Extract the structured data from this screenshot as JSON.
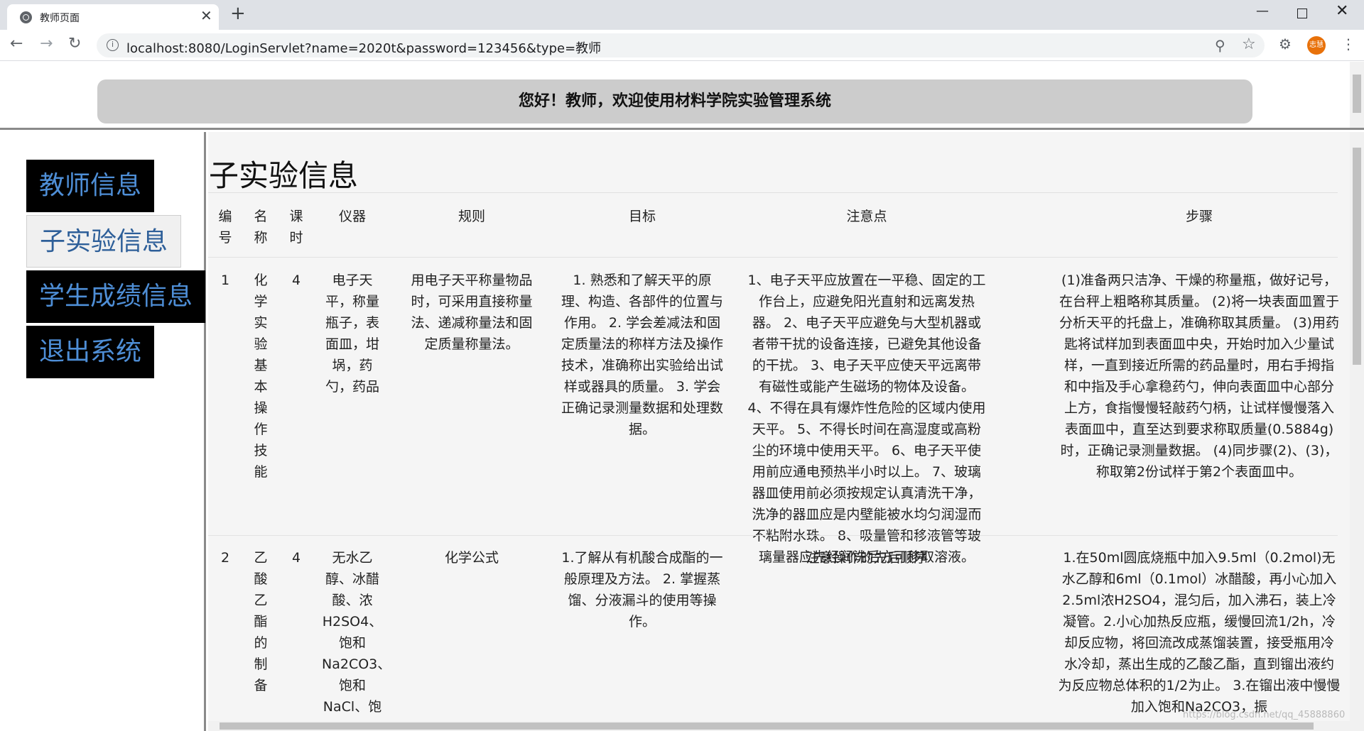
{
  "browser": {
    "tab_title": "教师页面",
    "tab_close": "✕",
    "new_tab": "+",
    "url": "localhost:8080/LoginServlet?name=2020t&password=123456&type=教师",
    "avatar_text": "志慧"
  },
  "header": {
    "welcome": "您好！教师，欢迎使用材料学院实验管理系统"
  },
  "sidebar": {
    "items": [
      {
        "label": "教师信息"
      },
      {
        "label": "子实验信息"
      },
      {
        "label": "学生成绩信息"
      },
      {
        "label": "退出系统"
      }
    ]
  },
  "main": {
    "title": "子实验信息",
    "columns": [
      "编号",
      "名称",
      "课时",
      "仪器",
      "规则",
      "目标",
      "注意点",
      "步骤"
    ],
    "rows": [
      {
        "id": "1",
        "name": "化学实验基本操作技能",
        "hours": "4",
        "instruments": "电子天平，称量瓶子，表面皿，坩埚，药勺，药品",
        "rules": "用电子天平称量物品时，可采用直接称量法、递减称量法和固定质量称量法。",
        "goals": "1. 熟悉和了解天平的原理、构造、各部件的位置与作用。 2. 学会差减法和固定质量法的称样方法及操作技术，准确称出实验给出试样或器具的质量。 3. 学会正确记录测量数据和处理数据。",
        "notes": "1、电子天平应放置在一平稳、固定的工作台上，应避免阳光直射和远离发热器。 2、电子天平应避免与大型机器或者带干扰的设备连接，已避免其他设备的干扰。 3、电子天平应使天平远离带有磁性或能产生磁场的物体及设备。 4、不得在具有爆炸性危险的区域内使用天平。 5、不得长时间在高湿度或高粉尘的环境中使用天平。 6、电子天平使用前应通电预热半小时以上。 7、玻璃器皿使用前必须按规定认真清洗干净，洗净的器皿应是内壁能被水均匀润湿而不粘附水珠。 8、吸量管和移液管等玻璃量器应先经润洗后方可移取溶液。",
        "steps": "(1)准备两只洁净、干燥的称量瓶，做好记号，在台秤上粗略称其质量。 (2)将一块表面皿置于分析天平的托盘上，准确称取其质量。 (3)用药匙将试样加到表面皿中央，开始时加入少量试样，一直到接近所需的药品量时，用右手拇指和中指及手心拿稳药勺，伸向表面皿中心部分上方，食指慢慢轻敲药勺柄，让试样慢慢落入表面皿中，直至达到要求称取质量(0.5884g)时，正确记录测量数据。 (4)同步骤(2)、(3)，称取第2份试样于第2个表面皿中。"
      },
      {
        "id": "2",
        "name": "乙酸乙酯的制备",
        "hours": "4",
        "instruments": "无水乙醇、冰醋酸、浓H2SO4、饱和Na2CO3、饱和NaCl、饱",
        "rules": "化学公式",
        "goals": "1.了解从有机酸合成酯的一般原理及方法。 2. 掌握蒸馏、分液漏斗的使用等操作。",
        "notes": "注意操作的先后顺序",
        "steps": "1.在50ml圆底烧瓶中加入9.5ml（0.2mol)无水乙醇和6ml（0.1mol）冰醋酸，再小心加入2.5ml浓H2SO4，混匀后，加入沸石，装上冷凝管。2.小心加热反应瓶，缓慢回流1/2h，冷却反应物，将回流改成蒸馏装置，接受瓶用冷水冷却，蒸出生成的乙酸乙酯，直到镏出液约为反应物总体积的1/2为止。 3.在镏出液中慢慢加入饱和Na2CO3，振"
      }
    ]
  },
  "watermark": "https://blog.csdn.net/qq_45888860"
}
